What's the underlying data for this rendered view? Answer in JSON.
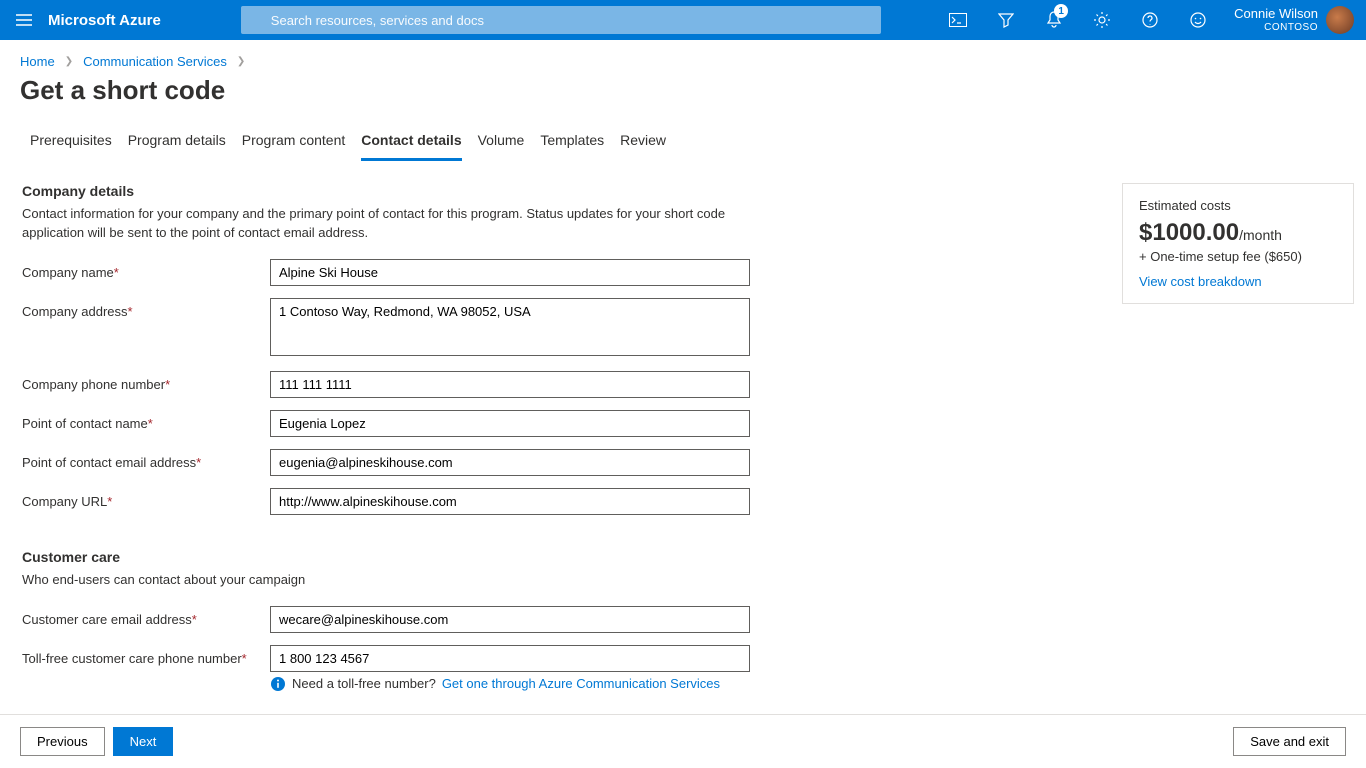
{
  "topbar": {
    "brand": "Microsoft Azure",
    "search_placeholder": "Search resources, services and docs",
    "notification_count": "1",
    "user_name": "Connie Wilson",
    "tenant": "CONTOSO"
  },
  "breadcrumb": {
    "home": "Home",
    "service": "Communication Services"
  },
  "page_title": "Get a short code",
  "tabs": [
    {
      "label": "Prerequisites"
    },
    {
      "label": "Program details"
    },
    {
      "label": "Program content"
    },
    {
      "label": "Contact details",
      "active": true
    },
    {
      "label": "Volume"
    },
    {
      "label": "Templates"
    },
    {
      "label": "Review"
    }
  ],
  "company": {
    "section_title": "Company details",
    "section_desc": "Contact information for your company and the primary point of contact for this program. Status updates for your short code application will be sent to the point of contact email address.",
    "name_label": "Company name",
    "name_value": "Alpine Ski House",
    "address_label": "Company address",
    "address_value": "1 Contoso Way, Redmond, WA 98052, USA",
    "phone_label": "Company phone number",
    "phone_value": "111 111 1111",
    "poc_name_label": "Point of contact name",
    "poc_name_value": "Eugenia Lopez",
    "poc_email_label": "Point of contact email address",
    "poc_email_value": "eugenia@alpineskihouse.com",
    "url_label": "Company URL",
    "url_value": "http://www.alpineskihouse.com"
  },
  "care": {
    "section_title": "Customer care",
    "section_desc": "Who end-users can contact about your campaign",
    "email_label": "Customer care email address",
    "email_value": "wecare@alpineskihouse.com",
    "tollfree_label": "Toll-free customer care phone number",
    "tollfree_value": "1 800 123 4567",
    "hint_text": "Need a toll-free number? ",
    "hint_link": "Get one through Azure Communication Services"
  },
  "costs": {
    "title": "Estimated costs",
    "price": "$1000.00",
    "per": "/month",
    "fee": "+ One-time setup fee ($650)",
    "link": "View cost breakdown"
  },
  "footer": {
    "prev": "Previous",
    "next": "Next",
    "save": "Save and exit"
  }
}
